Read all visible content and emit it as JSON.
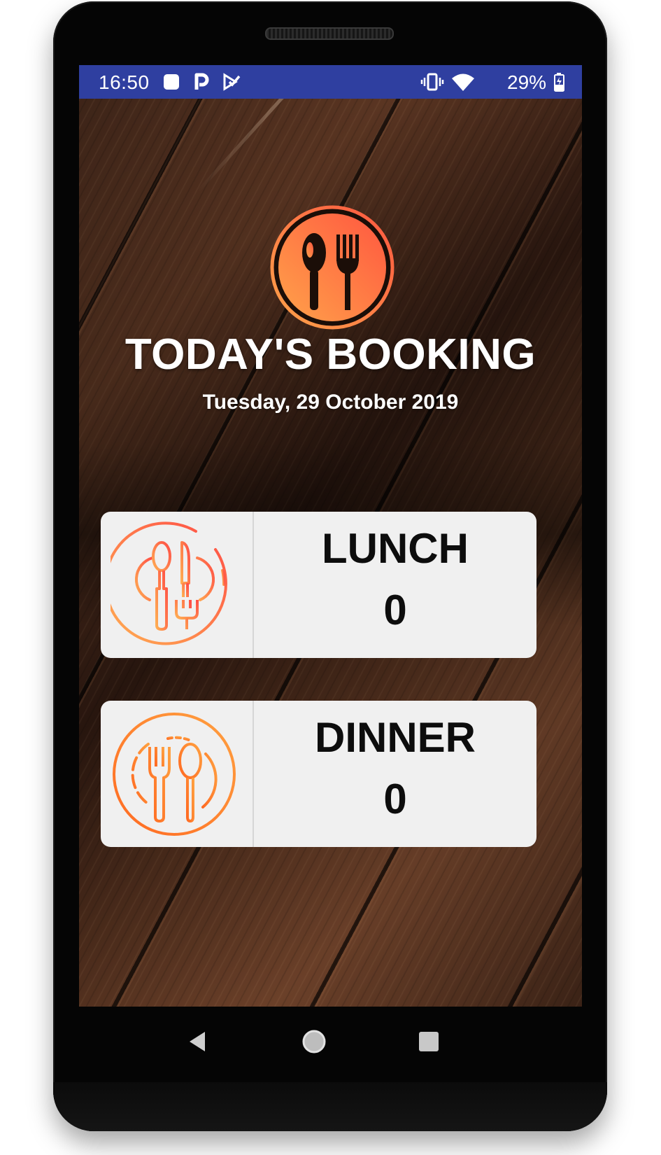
{
  "status_bar": {
    "time": "16:50",
    "battery": "29%",
    "background_color": "#2f3fa0",
    "left_icons": [
      "notification-square-icon",
      "p-app-icon",
      "task-check-icon"
    ],
    "right_icons": [
      "vibrate-icon",
      "wifi-icon",
      "battery-charging-icon"
    ]
  },
  "header": {
    "logo_icon": "spoon-fork-logo-icon",
    "title": "TODAY'S BOOKING",
    "date": "Tuesday, 29 October 2019"
  },
  "cards": [
    {
      "label": "LUNCH",
      "count": "0",
      "icon": "lunch-cutlery-icon"
    },
    {
      "label": "DINNER",
      "count": "0",
      "icon": "dinner-cutlery-icon"
    }
  ],
  "accent_gradient": [
    "#ff9a48",
    "#ff5a3c"
  ],
  "nav_bar": {
    "icons": [
      "back-icon",
      "home-icon",
      "recents-icon"
    ]
  }
}
